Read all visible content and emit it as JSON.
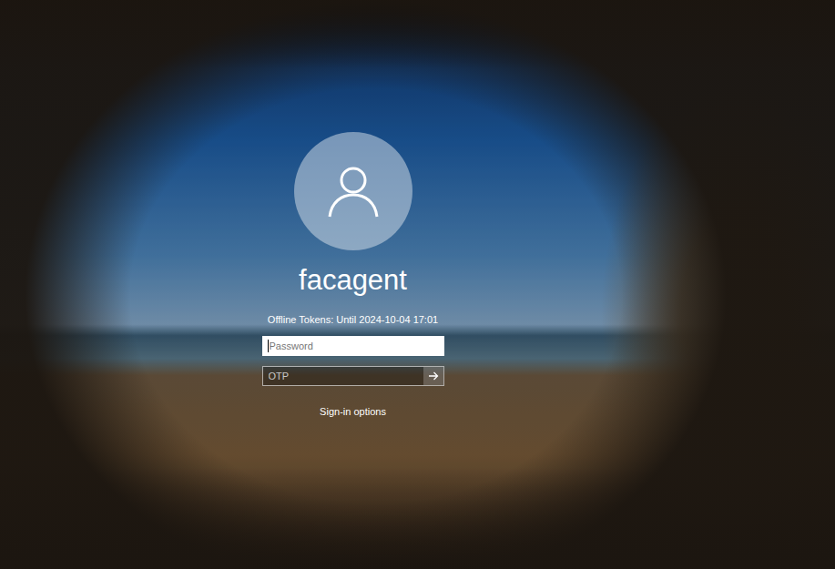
{
  "user": {
    "name": "facagent"
  },
  "status": "Offline Tokens: Until 2024-10-04 17:01",
  "fields": [
    {
      "placeholder": "Password",
      "focused": true,
      "has_submit": false
    },
    {
      "placeholder": "OTP",
      "focused": false,
      "has_submit": true
    }
  ],
  "link": "Sign-in options"
}
